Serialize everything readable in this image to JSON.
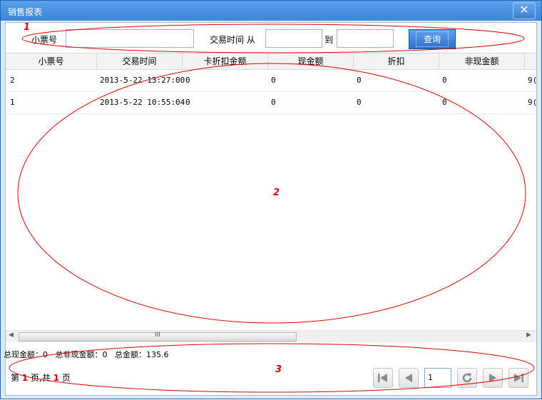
{
  "window": {
    "title": "销售报表",
    "close_glyph": "✕"
  },
  "search": {
    "ticket_label": "小票号",
    "ticket_value": "",
    "time_label": "交易时间 从",
    "from_value": "",
    "to_label": "到",
    "to_value": "",
    "query_label": "查询"
  },
  "table": {
    "columns": [
      "小票号",
      "交易时间",
      "卡折扣金额",
      "现金额",
      "折扣",
      "非现金额"
    ],
    "rows": [
      {
        "ticket": "2",
        "time": "2013-5-22 13:27:00",
        "card_discount": "0",
        "cash": "0",
        "discount": "0",
        "noncash": "0",
        "overflow": "9("
      },
      {
        "ticket": "1",
        "time": "2013-5-22 10:55:04",
        "card_discount": "0",
        "cash": "0",
        "discount": "0",
        "noncash": "0",
        "overflow": "9("
      }
    ],
    "scroll_grip": "III"
  },
  "summary": {
    "total_cash": "总现金额：0",
    "total_noncash": "总非现金额：0",
    "total": "总金额：135.6"
  },
  "pager": {
    "prefix": "第",
    "current": "1",
    "mid": "页,共",
    "total": "1",
    "suffix": "页",
    "page_input": "1",
    "first_icon": "first-page-icon",
    "prev_icon": "prev-page-icon",
    "refresh_icon": "refresh-icon",
    "next_icon": "next-page-icon",
    "last_icon": "last-page-icon"
  },
  "annotations": {
    "label1": "1",
    "label2": "2",
    "label3": "3"
  },
  "colors": {
    "title_bar": "#3b85d8",
    "annotation": "#e00000",
    "query_button": "#2d6fcc"
  }
}
